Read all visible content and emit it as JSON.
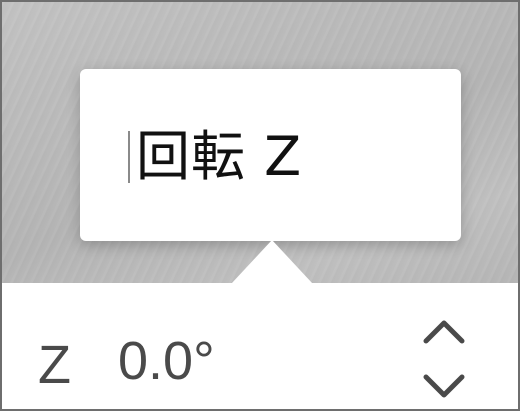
{
  "tooltip": {
    "text": "回転 Z"
  },
  "control": {
    "axis_label": "Z",
    "value": "0.0°"
  },
  "icons": {
    "increment": "chevron-up-icon",
    "decrement": "chevron-down-icon"
  },
  "colors": {
    "backdrop": "#bcbcbc",
    "tooltip_bg": "#ffffff",
    "text_dark": "#111111",
    "text_muted": "#4a4a4a"
  }
}
